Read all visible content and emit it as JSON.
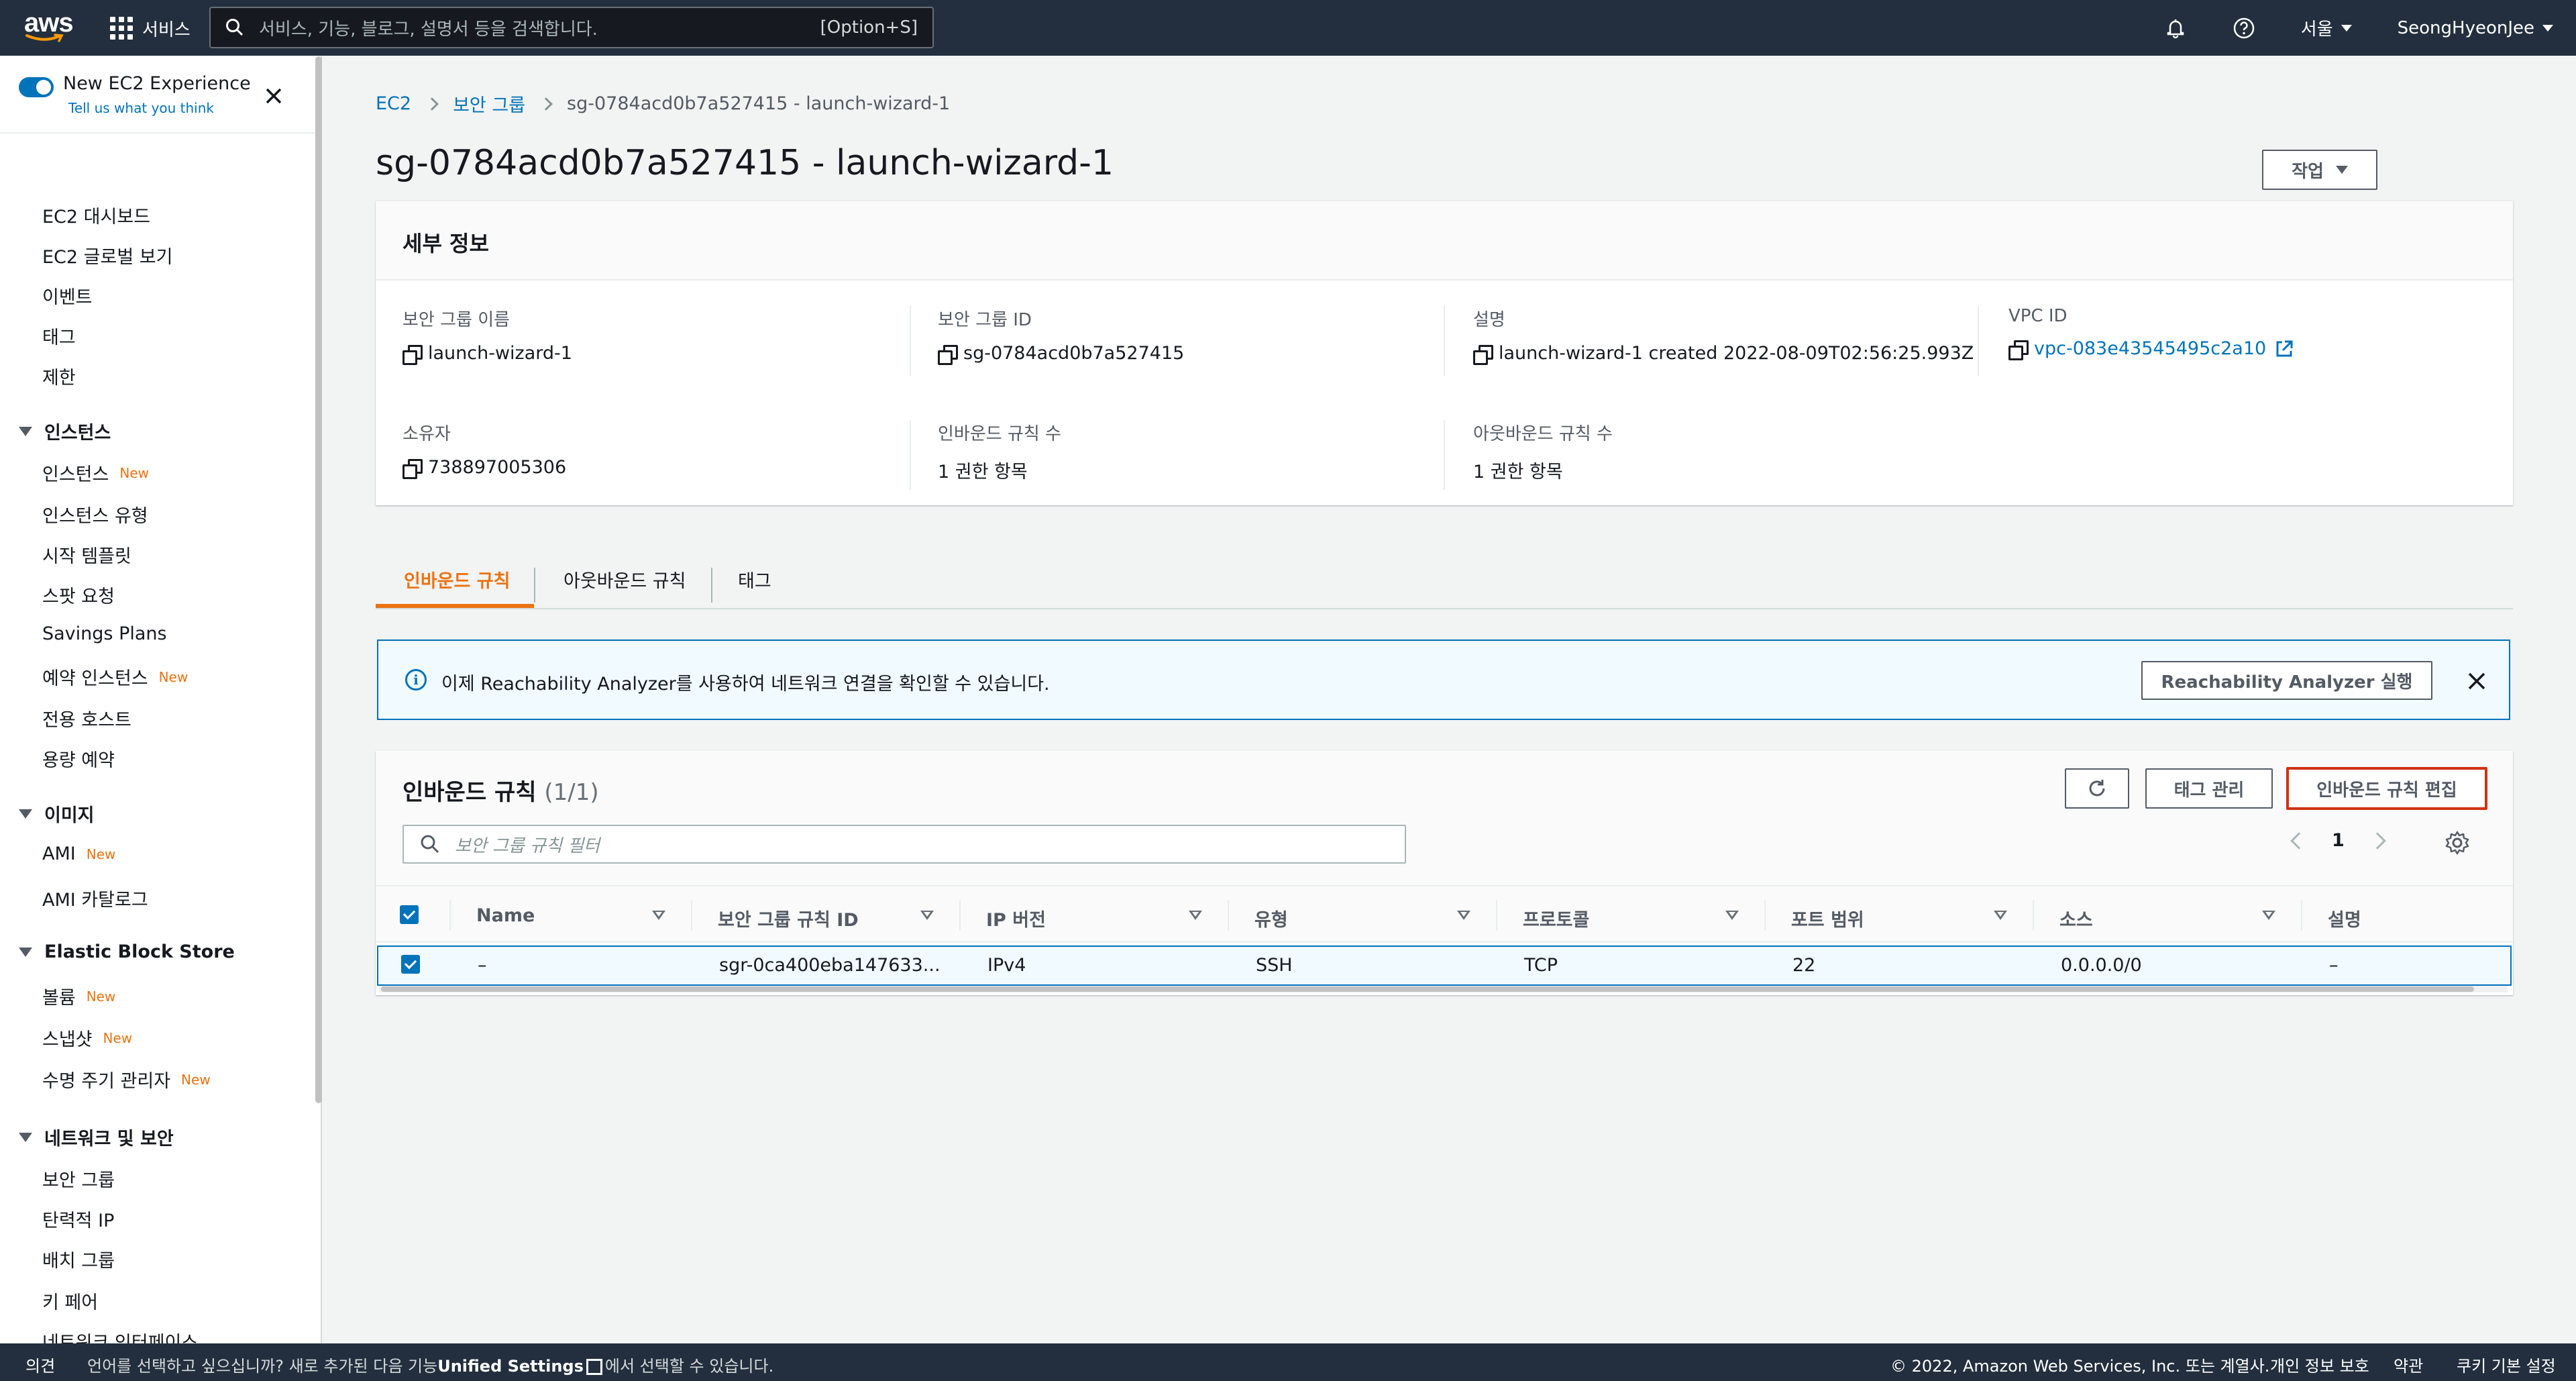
{
  "topbar": {
    "logo": "aws",
    "services": "서비스",
    "search_placeholder": "서비스, 기능, 블로그, 설명서 등을 검색합니다.",
    "search_shortcut": "[Option+S]",
    "region": "서울",
    "user": "SeongHyeonJee"
  },
  "sidebar": {
    "experience_title": "New EC2 Experience",
    "experience_sub": "Tell us what you think",
    "items_top": [
      "EC2 대시보드",
      "EC2 글로벌 보기",
      "이벤트",
      "태그",
      "제한"
    ],
    "sections": [
      {
        "title": "인스턴스",
        "items": [
          {
            "label": "인스턴스",
            "badge": "New"
          },
          {
            "label": "인스턴스 유형",
            "badge": ""
          },
          {
            "label": "시작 템플릿",
            "badge": ""
          },
          {
            "label": "스팟 요청",
            "badge": ""
          },
          {
            "label": "Savings Plans",
            "badge": ""
          },
          {
            "label": "예약 인스턴스",
            "badge": "New"
          },
          {
            "label": "전용 호스트",
            "badge": ""
          },
          {
            "label": "용량 예약",
            "badge": ""
          }
        ]
      },
      {
        "title": "이미지",
        "items": [
          {
            "label": "AMI",
            "badge": "New"
          },
          {
            "label": "AMI 카탈로그",
            "badge": ""
          }
        ]
      },
      {
        "title": "Elastic Block Store",
        "items": [
          {
            "label": "볼륨",
            "badge": "New"
          },
          {
            "label": "스냅샷",
            "badge": "New"
          },
          {
            "label": "수명 주기 관리자",
            "badge": "New"
          }
        ]
      },
      {
        "title": "네트워크 및 보안",
        "items": [
          {
            "label": "보안 그룹",
            "badge": ""
          },
          {
            "label": "탄력적 IP",
            "badge": ""
          },
          {
            "label": "배치 그룹",
            "badge": ""
          },
          {
            "label": "키 페어",
            "badge": ""
          },
          {
            "label": "네트워크 인터페이스",
            "badge": ""
          }
        ]
      }
    ]
  },
  "breadcrumb": [
    "EC2",
    "보안 그룹",
    "sg-0784acd0b7a527415 - launch-wizard-1"
  ],
  "page_title": "sg-0784acd0b7a527415 - launch-wizard-1",
  "actions_label": "작업",
  "details": {
    "title": "세부 정보",
    "fields": [
      {
        "label": "보안 그룹 이름",
        "value": "launch-wizard-1"
      },
      {
        "label": "보안 그룹 ID",
        "value": "sg-0784acd0b7a527415"
      },
      {
        "label": "설명",
        "value": "launch-wizard-1 created 2022-08-09T02:56:25.993Z"
      },
      {
        "label": "VPC ID",
        "value": "vpc-083e43545495c2a10"
      },
      {
        "label": "소유자",
        "value": "738897005306"
      },
      {
        "label": "인바운드 규칙 수",
        "value": "1 권한 항목"
      },
      {
        "label": "아웃바운드 규칙 수",
        "value": "1 권한 항목"
      }
    ]
  },
  "tabs": [
    "인바운드 규칙",
    "아웃바운드 규칙",
    "태그"
  ],
  "alert": {
    "text": "이제 Reachability Analyzer를 사용하여 네트워크 연결을 확인할 수 있습니다.",
    "button": "Reachability Analyzer 실행"
  },
  "rules_table": {
    "title": "인바운드 규칙",
    "count": "(1/1)",
    "manage_tags": "태그 관리",
    "edit_button": "인바운드 규칙 편집",
    "filter_placeholder": "보안 그룹 규칙 필터",
    "page": "1",
    "columns": [
      "Name",
      "보안 그룹 규칙 ID",
      "IP 버전",
      "유형",
      "프로토콜",
      "포트 범위",
      "소스",
      "설명"
    ],
    "rows": [
      [
        "–",
        "sgr-0ca400eba147633...",
        "IPv4",
        "SSH",
        "TCP",
        "22",
        "0.0.0.0/0",
        "–"
      ]
    ]
  },
  "footer": {
    "feedback": "의견",
    "lang_pre": "언어를 선택하고 싶으십니까? 새로 추가된 다음 기능",
    "lang_link": "Unified Settings",
    "lang_post": "에서 선택할 수 있습니다.",
    "copyright": "© 2022, Amazon Web Services, Inc. 또는 계열사.",
    "privacy": "개인 정보 보호",
    "terms": "약관",
    "cookies": "쿠키 기본 설정"
  }
}
